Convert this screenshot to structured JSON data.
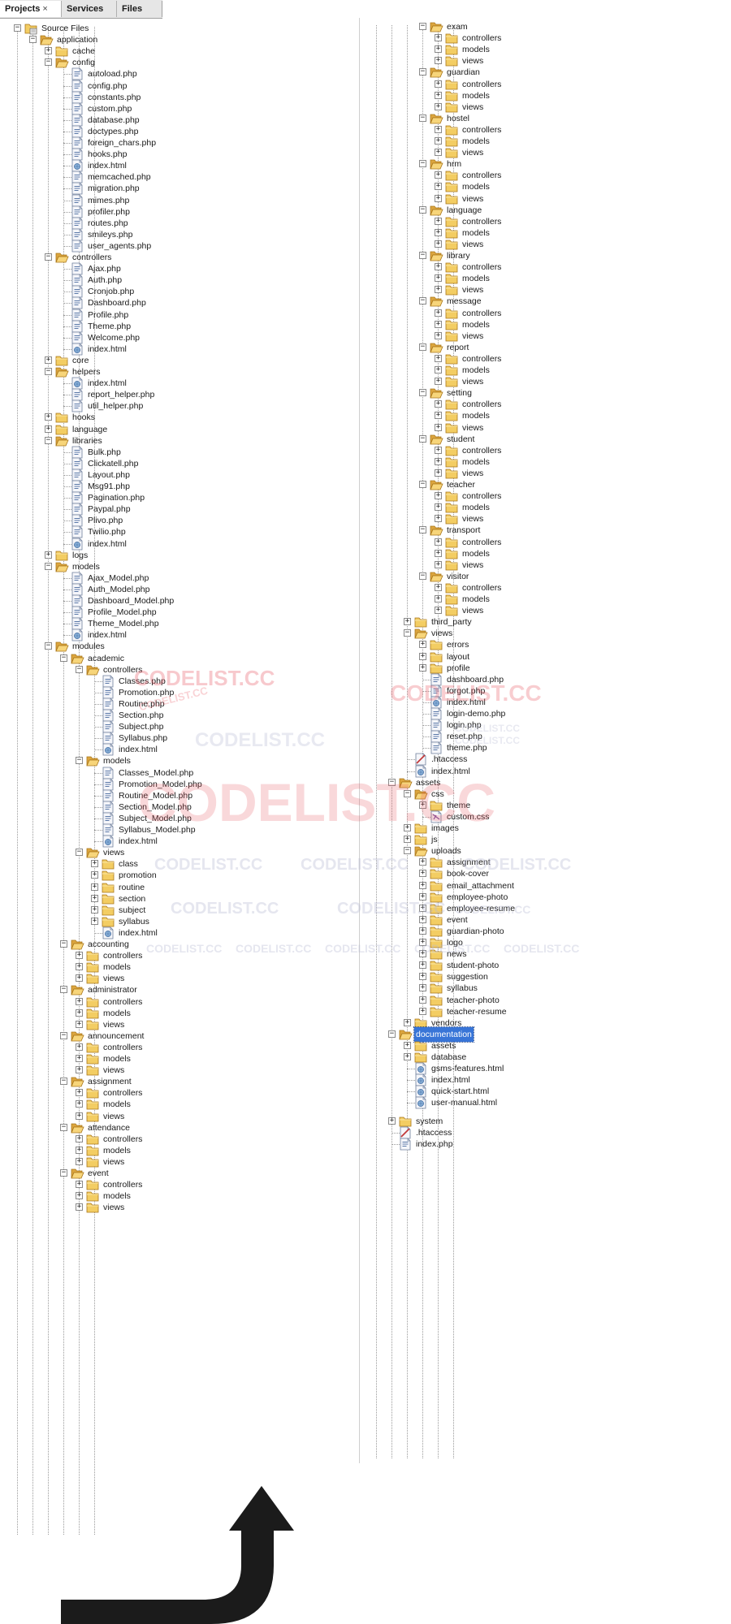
{
  "tabs": [
    {
      "label": "Projects",
      "active": true
    },
    {
      "label": "Services",
      "active": false
    },
    {
      "label": "Files",
      "active": false
    }
  ],
  "tab_close_glyph": "×",
  "watermark": "CODELIST.CC",
  "watermark_color": "#e8505b",
  "watermark_faint_color": "#b6b9d2",
  "selection_color": "#3875d7",
  "col1": [
    {
      "d": 0,
      "n": "Source Files",
      "t": "root",
      "o": true
    },
    {
      "d": 1,
      "n": "application",
      "t": "folder",
      "o": true
    },
    {
      "d": 2,
      "n": "cache",
      "t": "folder",
      "o": false
    },
    {
      "d": 2,
      "n": "config",
      "t": "folder",
      "o": true
    },
    {
      "d": 3,
      "n": "autoload.php",
      "t": "php"
    },
    {
      "d": 3,
      "n": "config.php",
      "t": "php"
    },
    {
      "d": 3,
      "n": "constants.php",
      "t": "php"
    },
    {
      "d": 3,
      "n": "custom.php",
      "t": "php"
    },
    {
      "d": 3,
      "n": "database.php",
      "t": "php"
    },
    {
      "d": 3,
      "n": "doctypes.php",
      "t": "php"
    },
    {
      "d": 3,
      "n": "foreign_chars.php",
      "t": "php"
    },
    {
      "d": 3,
      "n": "hooks.php",
      "t": "php"
    },
    {
      "d": 3,
      "n": "index.html",
      "t": "html"
    },
    {
      "d": 3,
      "n": "memcached.php",
      "t": "php"
    },
    {
      "d": 3,
      "n": "migration.php",
      "t": "php"
    },
    {
      "d": 3,
      "n": "mimes.php",
      "t": "php"
    },
    {
      "d": 3,
      "n": "profiler.php",
      "t": "php"
    },
    {
      "d": 3,
      "n": "routes.php",
      "t": "php"
    },
    {
      "d": 3,
      "n": "smileys.php",
      "t": "php"
    },
    {
      "d": 3,
      "n": "user_agents.php",
      "t": "php"
    },
    {
      "d": 2,
      "n": "controllers",
      "t": "folder",
      "o": true
    },
    {
      "d": 3,
      "n": "Ajax.php",
      "t": "php"
    },
    {
      "d": 3,
      "n": "Auth.php",
      "t": "php"
    },
    {
      "d": 3,
      "n": "Cronjob.php",
      "t": "php"
    },
    {
      "d": 3,
      "n": "Dashboard.php",
      "t": "php"
    },
    {
      "d": 3,
      "n": "Profile.php",
      "t": "php"
    },
    {
      "d": 3,
      "n": "Theme.php",
      "t": "php"
    },
    {
      "d": 3,
      "n": "Welcome.php",
      "t": "php"
    },
    {
      "d": 3,
      "n": "index.html",
      "t": "html"
    },
    {
      "d": 2,
      "n": "core",
      "t": "folder",
      "o": false
    },
    {
      "d": 2,
      "n": "helpers",
      "t": "folder",
      "o": true
    },
    {
      "d": 3,
      "n": "index.html",
      "t": "html"
    },
    {
      "d": 3,
      "n": "report_helper.php",
      "t": "php"
    },
    {
      "d": 3,
      "n": "util_helper.php",
      "t": "php"
    },
    {
      "d": 2,
      "n": "hooks",
      "t": "folder",
      "o": false
    },
    {
      "d": 2,
      "n": "language",
      "t": "folder",
      "o": false
    },
    {
      "d": 2,
      "n": "libraries",
      "t": "folder",
      "o": true
    },
    {
      "d": 3,
      "n": "Bulk.php",
      "t": "php"
    },
    {
      "d": 3,
      "n": "Clickatell.php",
      "t": "php"
    },
    {
      "d": 3,
      "n": "Layout.php",
      "t": "php"
    },
    {
      "d": 3,
      "n": "Msg91.php",
      "t": "php"
    },
    {
      "d": 3,
      "n": "Pagination.php",
      "t": "php"
    },
    {
      "d": 3,
      "n": "Paypal.php",
      "t": "php"
    },
    {
      "d": 3,
      "n": "Plivo.php",
      "t": "php"
    },
    {
      "d": 3,
      "n": "Twilio.php",
      "t": "php"
    },
    {
      "d": 3,
      "n": "index.html",
      "t": "html"
    },
    {
      "d": 2,
      "n": "logs",
      "t": "folder",
      "o": false
    },
    {
      "d": 2,
      "n": "models",
      "t": "folder",
      "o": true
    },
    {
      "d": 3,
      "n": "Ajax_Model.php",
      "t": "php"
    },
    {
      "d": 3,
      "n": "Auth_Model.php",
      "t": "php"
    },
    {
      "d": 3,
      "n": "Dashboard_Model.php",
      "t": "php"
    },
    {
      "d": 3,
      "n": "Profile_Model.php",
      "t": "php"
    },
    {
      "d": 3,
      "n": "Theme_Model.php",
      "t": "php"
    },
    {
      "d": 3,
      "n": "index.html",
      "t": "html"
    },
    {
      "d": 2,
      "n": "modules",
      "t": "folder",
      "o": true
    },
    {
      "d": 3,
      "n": "academic",
      "t": "folder",
      "o": true
    },
    {
      "d": 4,
      "n": "controllers",
      "t": "folder",
      "o": true
    },
    {
      "d": 5,
      "n": "Classes.php",
      "t": "php"
    },
    {
      "d": 5,
      "n": "Promotion.php",
      "t": "php"
    },
    {
      "d": 5,
      "n": "Routine.php",
      "t": "php"
    },
    {
      "d": 5,
      "n": "Section.php",
      "t": "php"
    },
    {
      "d": 5,
      "n": "Subject.php",
      "t": "php"
    },
    {
      "d": 5,
      "n": "Syllabus.php",
      "t": "php"
    },
    {
      "d": 5,
      "n": "index.html",
      "t": "html"
    },
    {
      "d": 4,
      "n": "models",
      "t": "folder",
      "o": true
    },
    {
      "d": 5,
      "n": "Classes_Model.php",
      "t": "php"
    },
    {
      "d": 5,
      "n": "Promotion_Model.php",
      "t": "php"
    },
    {
      "d": 5,
      "n": "Routine_Model.php",
      "t": "php"
    },
    {
      "d": 5,
      "n": "Section_Model.php",
      "t": "php"
    },
    {
      "d": 5,
      "n": "Subject_Model.php",
      "t": "php"
    },
    {
      "d": 5,
      "n": "Syllabus_Model.php",
      "t": "php"
    },
    {
      "d": 5,
      "n": "index.html",
      "t": "html"
    },
    {
      "d": 4,
      "n": "views",
      "t": "folder",
      "o": true
    },
    {
      "d": 5,
      "n": "class",
      "t": "folder",
      "o": false
    },
    {
      "d": 5,
      "n": "promotion",
      "t": "folder",
      "o": false
    },
    {
      "d": 5,
      "n": "routine",
      "t": "folder",
      "o": false
    },
    {
      "d": 5,
      "n": "section",
      "t": "folder",
      "o": false
    },
    {
      "d": 5,
      "n": "subject",
      "t": "folder",
      "o": false
    },
    {
      "d": 5,
      "n": "syllabus",
      "t": "folder",
      "o": false
    },
    {
      "d": 5,
      "n": "index.html",
      "t": "html"
    },
    {
      "d": 3,
      "n": "accounting",
      "t": "folder",
      "o": true
    },
    {
      "d": 4,
      "n": "controllers",
      "t": "folder",
      "o": false
    },
    {
      "d": 4,
      "n": "models",
      "t": "folder",
      "o": false
    },
    {
      "d": 4,
      "n": "views",
      "t": "folder",
      "o": false
    },
    {
      "d": 3,
      "n": "administrator",
      "t": "folder",
      "o": true
    },
    {
      "d": 4,
      "n": "controllers",
      "t": "folder",
      "o": false
    },
    {
      "d": 4,
      "n": "models",
      "t": "folder",
      "o": false
    },
    {
      "d": 4,
      "n": "views",
      "t": "folder",
      "o": false
    },
    {
      "d": 3,
      "n": "announcement",
      "t": "folder",
      "o": true
    },
    {
      "d": 4,
      "n": "controllers",
      "t": "folder",
      "o": false
    },
    {
      "d": 4,
      "n": "models",
      "t": "folder",
      "o": false
    },
    {
      "d": 4,
      "n": "views",
      "t": "folder",
      "o": false
    },
    {
      "d": 3,
      "n": "assignment",
      "t": "folder",
      "o": true
    },
    {
      "d": 4,
      "n": "controllers",
      "t": "folder",
      "o": false
    },
    {
      "d": 4,
      "n": "models",
      "t": "folder",
      "o": false
    },
    {
      "d": 4,
      "n": "views",
      "t": "folder",
      "o": false
    },
    {
      "d": 3,
      "n": "attendance",
      "t": "folder",
      "o": true
    },
    {
      "d": 4,
      "n": "controllers",
      "t": "folder",
      "o": false
    },
    {
      "d": 4,
      "n": "models",
      "t": "folder",
      "o": false
    },
    {
      "d": 4,
      "n": "views",
      "t": "folder",
      "o": false
    },
    {
      "d": 3,
      "n": "event",
      "t": "folder",
      "o": true
    },
    {
      "d": 4,
      "n": "controllers",
      "t": "folder",
      "o": false
    },
    {
      "d": 4,
      "n": "models",
      "t": "folder",
      "o": false
    },
    {
      "d": 4,
      "n": "views",
      "t": "folder",
      "o": false
    }
  ],
  "col2": [
    {
      "d": 3,
      "n": "exam",
      "t": "folder",
      "o": true
    },
    {
      "d": 4,
      "n": "controllers",
      "t": "folder",
      "o": false
    },
    {
      "d": 4,
      "n": "models",
      "t": "folder",
      "o": false
    },
    {
      "d": 4,
      "n": "views",
      "t": "folder",
      "o": false
    },
    {
      "d": 3,
      "n": "guardian",
      "t": "folder",
      "o": true
    },
    {
      "d": 4,
      "n": "controllers",
      "t": "folder",
      "o": false
    },
    {
      "d": 4,
      "n": "models",
      "t": "folder",
      "o": false
    },
    {
      "d": 4,
      "n": "views",
      "t": "folder",
      "o": false
    },
    {
      "d": 3,
      "n": "hostel",
      "t": "folder",
      "o": true
    },
    {
      "d": 4,
      "n": "controllers",
      "t": "folder",
      "o": false
    },
    {
      "d": 4,
      "n": "models",
      "t": "folder",
      "o": false
    },
    {
      "d": 4,
      "n": "views",
      "t": "folder",
      "o": false
    },
    {
      "d": 3,
      "n": "hrm",
      "t": "folder",
      "o": true
    },
    {
      "d": 4,
      "n": "controllers",
      "t": "folder",
      "o": false
    },
    {
      "d": 4,
      "n": "models",
      "t": "folder",
      "o": false
    },
    {
      "d": 4,
      "n": "views",
      "t": "folder",
      "o": false
    },
    {
      "d": 3,
      "n": "language",
      "t": "folder",
      "o": true
    },
    {
      "d": 4,
      "n": "controllers",
      "t": "folder",
      "o": false
    },
    {
      "d": 4,
      "n": "models",
      "t": "folder",
      "o": false
    },
    {
      "d": 4,
      "n": "views",
      "t": "folder",
      "o": false
    },
    {
      "d": 3,
      "n": "library",
      "t": "folder",
      "o": true
    },
    {
      "d": 4,
      "n": "controllers",
      "t": "folder",
      "o": false
    },
    {
      "d": 4,
      "n": "models",
      "t": "folder",
      "o": false
    },
    {
      "d": 4,
      "n": "views",
      "t": "folder",
      "o": false
    },
    {
      "d": 3,
      "n": "message",
      "t": "folder",
      "o": true
    },
    {
      "d": 4,
      "n": "controllers",
      "t": "folder",
      "o": false
    },
    {
      "d": 4,
      "n": "models",
      "t": "folder",
      "o": false
    },
    {
      "d": 4,
      "n": "views",
      "t": "folder",
      "o": false
    },
    {
      "d": 3,
      "n": "report",
      "t": "folder",
      "o": true
    },
    {
      "d": 4,
      "n": "controllers",
      "t": "folder",
      "o": false
    },
    {
      "d": 4,
      "n": "models",
      "t": "folder",
      "o": false
    },
    {
      "d": 4,
      "n": "views",
      "t": "folder",
      "o": false
    },
    {
      "d": 3,
      "n": "setting",
      "t": "folder",
      "o": true
    },
    {
      "d": 4,
      "n": "controllers",
      "t": "folder",
      "o": false
    },
    {
      "d": 4,
      "n": "models",
      "t": "folder",
      "o": false
    },
    {
      "d": 4,
      "n": "views",
      "t": "folder",
      "o": false
    },
    {
      "d": 3,
      "n": "student",
      "t": "folder",
      "o": true
    },
    {
      "d": 4,
      "n": "controllers",
      "t": "folder",
      "o": false
    },
    {
      "d": 4,
      "n": "models",
      "t": "folder",
      "o": false
    },
    {
      "d": 4,
      "n": "views",
      "t": "folder",
      "o": false
    },
    {
      "d": 3,
      "n": "teacher",
      "t": "folder",
      "o": true
    },
    {
      "d": 4,
      "n": "controllers",
      "t": "folder",
      "o": false
    },
    {
      "d": 4,
      "n": "models",
      "t": "folder",
      "o": false
    },
    {
      "d": 4,
      "n": "views",
      "t": "folder",
      "o": false
    },
    {
      "d": 3,
      "n": "transport",
      "t": "folder",
      "o": true
    },
    {
      "d": 4,
      "n": "controllers",
      "t": "folder",
      "o": false
    },
    {
      "d": 4,
      "n": "models",
      "t": "folder",
      "o": false
    },
    {
      "d": 4,
      "n": "views",
      "t": "folder",
      "o": false
    },
    {
      "d": 3,
      "n": "visitor",
      "t": "folder",
      "o": true
    },
    {
      "d": 4,
      "n": "controllers",
      "t": "folder",
      "o": false
    },
    {
      "d": 4,
      "n": "models",
      "t": "folder",
      "o": false
    },
    {
      "d": 4,
      "n": "views",
      "t": "folder",
      "o": false
    },
    {
      "d": 2,
      "n": "third_party",
      "t": "folder",
      "o": false
    },
    {
      "d": 2,
      "n": "views",
      "t": "folder",
      "o": true
    },
    {
      "d": 3,
      "n": "errors",
      "t": "folder",
      "o": false
    },
    {
      "d": 3,
      "n": "layout",
      "t": "folder",
      "o": false
    },
    {
      "d": 3,
      "n": "profile",
      "t": "folder",
      "o": false
    },
    {
      "d": 3,
      "n": "dashboard.php",
      "t": "php"
    },
    {
      "d": 3,
      "n": "forgot.php",
      "t": "php"
    },
    {
      "d": 3,
      "n": "index.html",
      "t": "html"
    },
    {
      "d": 3,
      "n": "login-demo.php",
      "t": "php"
    },
    {
      "d": 3,
      "n": "login.php",
      "t": "php"
    },
    {
      "d": 3,
      "n": "reset.php",
      "t": "php"
    },
    {
      "d": 3,
      "n": "theme.php",
      "t": "php"
    },
    {
      "d": 2,
      "n": ".htaccess",
      "t": "htaccess"
    },
    {
      "d": 2,
      "n": "index.html",
      "t": "html"
    },
    {
      "d": 1,
      "n": "assets",
      "t": "folder",
      "o": true
    },
    {
      "d": 2,
      "n": "css",
      "t": "folder",
      "o": true
    },
    {
      "d": 3,
      "n": "theme",
      "t": "folder",
      "o": false
    },
    {
      "d": 3,
      "n": "custom.css",
      "t": "css"
    },
    {
      "d": 2,
      "n": "images",
      "t": "folder",
      "o": false
    },
    {
      "d": 2,
      "n": "js",
      "t": "folder",
      "o": false
    },
    {
      "d": 2,
      "n": "uploads",
      "t": "folder",
      "o": true
    },
    {
      "d": 3,
      "n": "assignment",
      "t": "folder",
      "o": false
    },
    {
      "d": 3,
      "n": "book-cover",
      "t": "folder",
      "o": false
    },
    {
      "d": 3,
      "n": "email_attachment",
      "t": "folder",
      "o": false
    },
    {
      "d": 3,
      "n": "employee-photo",
      "t": "folder",
      "o": false
    },
    {
      "d": 3,
      "n": "employee-resume",
      "t": "folder",
      "o": false
    },
    {
      "d": 3,
      "n": "event",
      "t": "folder",
      "o": false
    },
    {
      "d": 3,
      "n": "guardian-photo",
      "t": "folder",
      "o": false
    },
    {
      "d": 3,
      "n": "logo",
      "t": "folder",
      "o": false
    },
    {
      "d": 3,
      "n": "news",
      "t": "folder",
      "o": false
    },
    {
      "d": 3,
      "n": "student-photo",
      "t": "folder",
      "o": false
    },
    {
      "d": 3,
      "n": "suggestion",
      "t": "folder",
      "o": false
    },
    {
      "d": 3,
      "n": "syllabus",
      "t": "folder",
      "o": false
    },
    {
      "d": 3,
      "n": "teacher-photo",
      "t": "folder",
      "o": false
    },
    {
      "d": 3,
      "n": "teacher-resume",
      "t": "folder",
      "o": false
    },
    {
      "d": 2,
      "n": "vendors",
      "t": "folder",
      "o": false
    },
    {
      "d": 1,
      "n": "documentation",
      "t": "folder",
      "o": true,
      "sel": true
    },
    {
      "d": 2,
      "n": "assets",
      "t": "folder",
      "o": false
    },
    {
      "d": 2,
      "n": "database",
      "t": "folder",
      "o": false
    },
    {
      "d": 2,
      "n": "gsms-features.html",
      "t": "html"
    },
    {
      "d": 2,
      "n": "index.html",
      "t": "html"
    },
    {
      "d": 2,
      "n": "quick-start.html",
      "t": "html"
    },
    {
      "d": 2,
      "n": "user-manual.html",
      "t": "html"
    },
    {
      "d": 1,
      "n": "system",
      "t": "folder",
      "o": false,
      "gap": true
    },
    {
      "d": 1,
      "n": ".htaccess",
      "t": "htaccess"
    },
    {
      "d": 1,
      "n": "index.php",
      "t": "php"
    }
  ]
}
